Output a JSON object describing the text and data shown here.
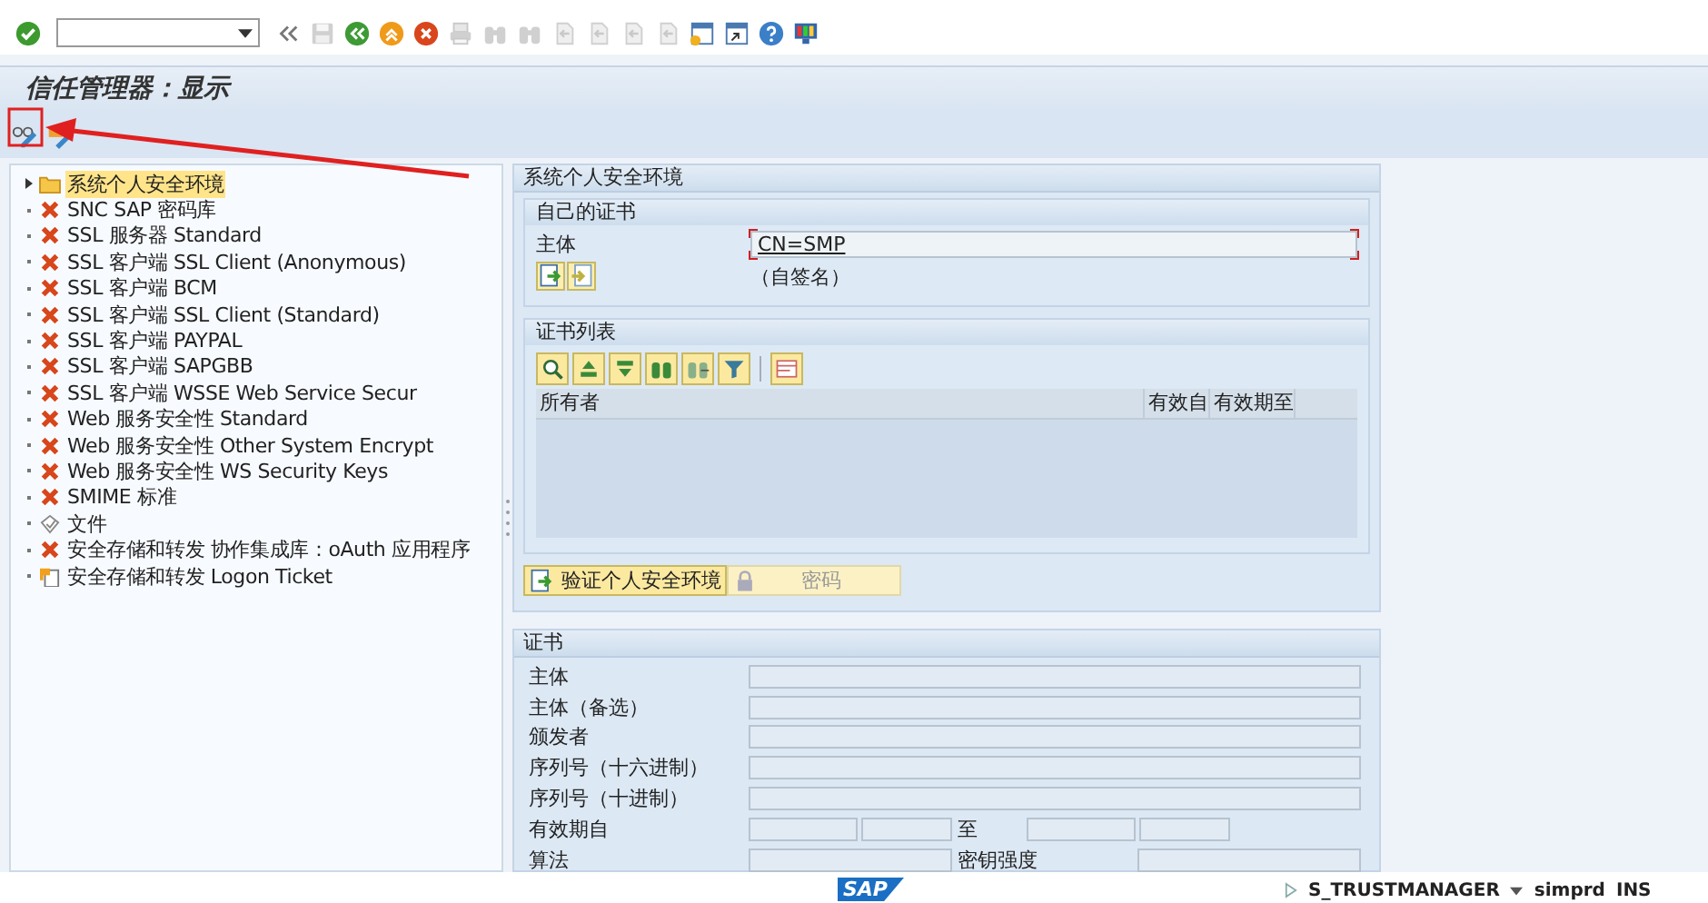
{
  "standard_toolbar": [
    {
      "kind": "ok",
      "disabled": false
    },
    {
      "kind": "command_field"
    },
    {
      "kind": "collapse",
      "disabled": false
    },
    {
      "kind": "save",
      "disabled": true
    },
    {
      "kind": "back",
      "disabled": false
    },
    {
      "kind": "exit",
      "disabled": false
    },
    {
      "kind": "cancel",
      "disabled": false
    },
    {
      "kind": "print",
      "disabled": true
    },
    {
      "kind": "find",
      "disabled": true
    },
    {
      "kind": "find",
      "disabled": true
    },
    {
      "kind": "page",
      "disabled": true
    },
    {
      "kind": "page",
      "disabled": true
    },
    {
      "kind": "page",
      "disabled": true
    },
    {
      "kind": "page",
      "disabled": true
    },
    {
      "kind": "new_session",
      "disabled": false
    },
    {
      "kind": "shortcut",
      "disabled": false
    },
    {
      "kind": "help",
      "disabled": false
    },
    {
      "kind": "layout",
      "disabled": false
    }
  ],
  "title": "信任管理器：显示",
  "app_toolbar": [
    {
      "kind": "display_change"
    },
    {
      "kind": "tools"
    }
  ],
  "tree": [
    {
      "label": "系统个人安全环境",
      "kind": "folder",
      "expandable": true,
      "selected": true
    },
    {
      "label": "SNC SAP 密码库",
      "kind": "error",
      "expandable": false,
      "selected": false
    },
    {
      "label": "SSL 服务器 Standard",
      "kind": "error",
      "expandable": false,
      "selected": false
    },
    {
      "label": "SSL 客户端 SSL Client (Anonymous)",
      "kind": "error",
      "expandable": false,
      "selected": false
    },
    {
      "label": "SSL 客户端 BCM",
      "kind": "error",
      "expandable": false,
      "selected": false
    },
    {
      "label": "SSL 客户端 SSL Client (Standard)",
      "kind": "error",
      "expandable": false,
      "selected": false
    },
    {
      "label": "SSL 客户端 PAYPAL",
      "kind": "error",
      "expandable": false,
      "selected": false
    },
    {
      "label": "SSL 客户端 SAPGBB",
      "kind": "error",
      "expandable": false,
      "selected": false
    },
    {
      "label": "SSL 客户端 WSSE Web Service Secur",
      "kind": "error",
      "expandable": false,
      "selected": false
    },
    {
      "label": "Web 服务安全性 Standard",
      "kind": "error",
      "expandable": false,
      "selected": false
    },
    {
      "label": "Web 服务安全性 Other System Encrypt",
      "kind": "error",
      "expandable": false,
      "selected": false
    },
    {
      "label": "Web 服务安全性 WS Security Keys",
      "kind": "error",
      "expandable": false,
      "selected": false
    },
    {
      "label": "SMIME 标准",
      "kind": "error",
      "expandable": false,
      "selected": false
    },
    {
      "label": "文件",
      "kind": "seal",
      "expandable": false,
      "selected": false
    },
    {
      "label": "安全存储和转发 协作集成库：oAuth 应用程序",
      "kind": "error",
      "expandable": false,
      "selected": false
    },
    {
      "label": "安全存储和转发 Logon Ticket",
      "kind": "ticket",
      "expandable": false,
      "selected": false
    }
  ],
  "pse_section": {
    "title": "系统个人安全环境",
    "own_certificate": {
      "title": "自己的证书",
      "subject_label": "主体",
      "subject": {
        "value": "CN=SMP",
        "required": true
      },
      "note": "（自签名）"
    },
    "certificate_list": {
      "title": "证书列表",
      "toolbar": [
        {
          "kind": "details"
        },
        {
          "kind": "sort_ascending"
        },
        {
          "kind": "sort_descending"
        },
        {
          "kind": "find"
        },
        {
          "kind": "find_next"
        },
        {
          "kind": "filter"
        },
        {
          "kind": "layout"
        }
      ],
      "columns": [
        "所有者",
        "有效自",
        "有效期至"
      ]
    },
    "buttons": [
      {
        "label": "验证个人安全环境",
        "kind": "verify",
        "disabled": false
      },
      {
        "label": "密码",
        "kind": "password",
        "disabled": true
      }
    ]
  },
  "certificate": {
    "title": "证书",
    "rows": [
      {
        "kind": "single",
        "label": "主体"
      },
      {
        "kind": "single",
        "label": "主体（备选）"
      },
      {
        "kind": "single",
        "label": "颁发者"
      },
      {
        "kind": "single",
        "label": "序列号（十六进制）"
      },
      {
        "kind": "single",
        "label": "序列号（十进制）"
      },
      {
        "kind": "date_range",
        "label": "有效期自",
        "label_2": "至"
      },
      {
        "kind": "pair",
        "label": "算法",
        "label_2": "密钥强度"
      }
    ]
  },
  "status_bar": {
    "logo": "SAP",
    "transaction": "S_TRUSTMANAGER",
    "system": "simprd",
    "mode": "INS"
  }
}
